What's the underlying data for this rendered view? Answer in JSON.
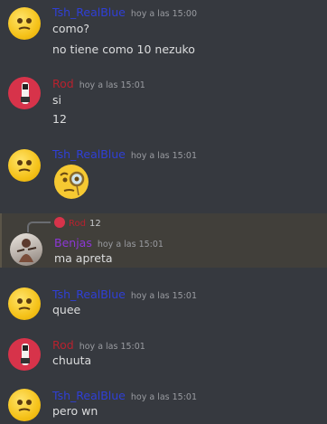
{
  "colors": {
    "background": "#36393f",
    "name_tsh": "#2f3fd6",
    "name_rod": "#b8212e",
    "name_benjas": "#8c37d6",
    "text": "#dcddde",
    "timestamp": "#9a9ca1"
  },
  "messages": [
    {
      "author": "Tsh_RealBlue",
      "time": "hoy a las 15:00",
      "lines": [
        "como?",
        "no tiene como 10 nezuko"
      ]
    },
    {
      "author": "Rod",
      "time": "hoy a las 15:01",
      "lines": [
        "si",
        "12"
      ]
    },
    {
      "author": "Tsh_RealBlue",
      "time": "hoy a las 15:01",
      "emoji": "face-with-monocle"
    },
    {
      "author": "Benjas",
      "time": "hoy a las 15:01",
      "reply_to": {
        "author": "Rod",
        "text": "12"
      },
      "lines": [
        "ma apreta"
      ]
    },
    {
      "author": "Tsh_RealBlue",
      "time": "hoy a las 15:01",
      "lines": [
        "quee"
      ]
    },
    {
      "author": "Rod",
      "time": "hoy a las 15:01",
      "lines": [
        "chuuta"
      ]
    },
    {
      "author": "Tsh_RealBlue",
      "time": "hoy a las 15:01",
      "lines": [
        "pero wn"
      ]
    }
  ]
}
